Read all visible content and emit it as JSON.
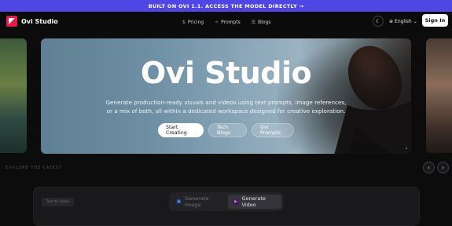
{
  "banner": {
    "text": "BUILT ON OVI 1.1. ACCESS THE MODEL DIRECTLY →"
  },
  "header": {
    "logo_text": "Ovi Studio",
    "nav": [
      {
        "label": "Pricing",
        "icon": "dollar-icon",
        "glyph": "$"
      },
      {
        "label": "Prompts",
        "icon": "sparkle-icon",
        "glyph": "✧"
      },
      {
        "label": "Blogs",
        "icon": "rss-icon",
        "glyph": "☰"
      }
    ],
    "theme_icon": "moon-icon",
    "language": "English",
    "signin_label": "Sign In"
  },
  "hero": {
    "title": "Ovi Studio",
    "subtitle": "Generate production-ready visuals and videos using text prompts, image references, or a mix of both, all within a dedicated workspace designed for creative exploration.",
    "cta_primary": "Start Creating",
    "cta_secondary": "Tech Blogs",
    "cta_tertiary": "Ovi Prompts"
  },
  "explore": {
    "label": "EXPLORE THE LATEST"
  },
  "panel": {
    "mode_chip": "Text to Video",
    "tabs": [
      {
        "label": "Generate Image",
        "icon": "image-icon",
        "active": false
      },
      {
        "label": "Generate Video",
        "icon": "video-icon",
        "active": true
      }
    ]
  },
  "colors": {
    "banner": "#4f46e5",
    "brand": "#e11d48",
    "background": "#0c0c0d"
  }
}
